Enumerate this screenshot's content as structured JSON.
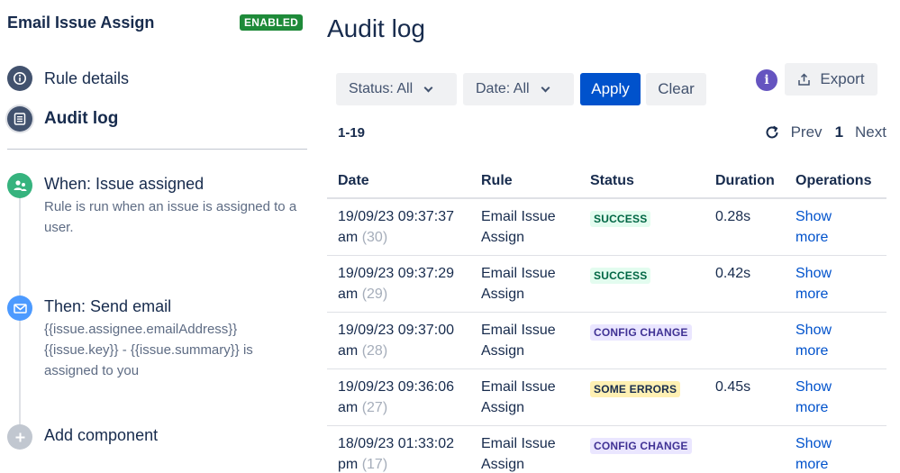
{
  "sidebar": {
    "rule_title": "Email Issue Assign",
    "status_badge": "ENABLED",
    "nav": [
      {
        "label": "Rule details",
        "icon": "info-icon"
      },
      {
        "label": "Audit log",
        "icon": "list-icon"
      }
    ],
    "components": [
      {
        "title": "When: Issue assigned",
        "description": "Rule is run when an issue is assigned to a user.",
        "icon": "user-assign-icon",
        "color": "#36b37e"
      },
      {
        "title": "Then: Send email",
        "description": "{{issue.assignee.emailAddress}} {{issue.key}} - {{issue.summary}} is assigned to you",
        "icon": "mail-icon",
        "color": "#4c9aff"
      },
      {
        "title": "Add component",
        "description": "",
        "icon": "plus-icon",
        "color": "#c1c7d0"
      }
    ]
  },
  "main": {
    "title": "Audit log",
    "filters": {
      "status": "Status: All",
      "date": "Date: All",
      "apply": "Apply",
      "clear": "Clear"
    },
    "info_icon_text": "i",
    "export_label": "Export",
    "range": "1-19",
    "pagination": {
      "prev": "Prev",
      "current": "1",
      "next": "Next"
    },
    "columns": [
      "Date",
      "Rule",
      "Status",
      "Duration",
      "Operations"
    ],
    "rows": [
      {
        "date": "19/09/23 09:37:37 am",
        "count": "(30)",
        "rule": "Email Issue Assign",
        "status": "SUCCESS",
        "duration": "0.28s",
        "op": "Show more"
      },
      {
        "date": "19/09/23 09:37:29 am",
        "count": "(29)",
        "rule": "Email Issue Assign",
        "status": "SUCCESS",
        "duration": "0.42s",
        "op": "Show more"
      },
      {
        "date": "19/09/23 09:37:00 am",
        "count": "(28)",
        "rule": "Email Issue Assign",
        "status": "CONFIG CHANGE",
        "duration": "",
        "op": "Show more"
      },
      {
        "date": "19/09/23 09:36:06 am",
        "count": "(27)",
        "rule": "Email Issue Assign",
        "status": "SOME ERRORS",
        "duration": "0.45s",
        "op": "Show more"
      },
      {
        "date": "18/09/23 01:33:02 pm",
        "count": "(17)",
        "rule": "Email Issue Assign",
        "status": "CONFIG CHANGE",
        "duration": "",
        "op": "Show more"
      }
    ],
    "status_colors": {
      "SUCCESS": {
        "bg": "#e3fcef",
        "fg": "#006644"
      },
      "CONFIG CHANGE": {
        "bg": "#eae6ff",
        "fg": "#403294"
      },
      "SOME ERRORS": {
        "bg": "#fff0b3",
        "fg": "#172b4d"
      }
    }
  }
}
